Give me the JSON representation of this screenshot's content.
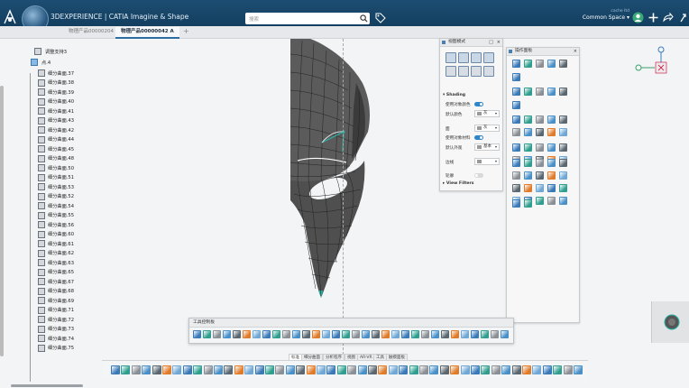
{
  "header": {
    "app_title": "3DEXPERIENCE | CATIA Imagine & Shape",
    "search_placeholder": "搜索",
    "user_name": "cache ltd",
    "space": "Common Space ▾"
  },
  "tabs": [
    {
      "label": "物理产品00000204"
    },
    {
      "label": "物理产品00000042 A"
    }
  ],
  "tree": {
    "items": [
      {
        "label": "调整支持3"
      },
      {
        "label": "点.4"
      },
      {
        "label": "细分曲面.37"
      },
      {
        "label": "细分曲面.38"
      },
      {
        "label": "细分曲面.39"
      },
      {
        "label": "细分曲面.40"
      },
      {
        "label": "细分曲面.41"
      },
      {
        "label": "细分曲面.43"
      },
      {
        "label": "细分曲面.42"
      },
      {
        "label": "细分曲面.44"
      },
      {
        "label": "细分曲面.45"
      },
      {
        "label": "细分曲面.48"
      },
      {
        "label": "细分曲面.50"
      },
      {
        "label": "细分曲面.51"
      },
      {
        "label": "细分曲面.53"
      },
      {
        "label": "细分曲面.52"
      },
      {
        "label": "细分曲面.54"
      },
      {
        "label": "细分曲面.55"
      },
      {
        "label": "细分曲面.56"
      },
      {
        "label": "细分曲面.60"
      },
      {
        "label": "细分曲面.61"
      },
      {
        "label": "细分曲面.62"
      },
      {
        "label": "细分曲面.63"
      },
      {
        "label": "细分曲面.65"
      },
      {
        "label": "细分曲面.67"
      },
      {
        "label": "细分曲面.68"
      },
      {
        "label": "细分曲面.69"
      },
      {
        "label": "细分曲面.71"
      },
      {
        "label": "细分曲面.72"
      },
      {
        "label": "细分曲面.73"
      },
      {
        "label": "细分曲面.74"
      },
      {
        "label": "细分曲面.75"
      }
    ]
  },
  "view_panel": {
    "title": "视图模式",
    "shading_title": "Shading",
    "row1_label": "使用对象颜色",
    "row2_label": "默认颜色",
    "row2_value": "灰",
    "section2_label": "面",
    "section2_value": "灰",
    "row3_label": "使用对象材料",
    "row4_label": "默认外观",
    "row4_value": "基本",
    "edges_label": "边线",
    "row5_label": "轮廓",
    "view_filters": "View Filters",
    "arrow_down": "▾",
    "arrow_right": "▸",
    "close": "×",
    "more": "□"
  },
  "tools_panel": {
    "title": "操作面板",
    "close": "×"
  },
  "tool_dock": {
    "title": "工具控制板"
  },
  "action_tabs": [
    {
      "label": "标准"
    },
    {
      "label": "细分曲面"
    },
    {
      "label": "分析程序"
    },
    {
      "label": "视图"
    },
    {
      "label": "AR-VR"
    },
    {
      "label": "工具"
    },
    {
      "label": "触摸面板"
    }
  ],
  "colors": {
    "topbar": "#163f61",
    "accent": "#2e86c8",
    "model": "#555555",
    "teal": "#27b3a4"
  }
}
